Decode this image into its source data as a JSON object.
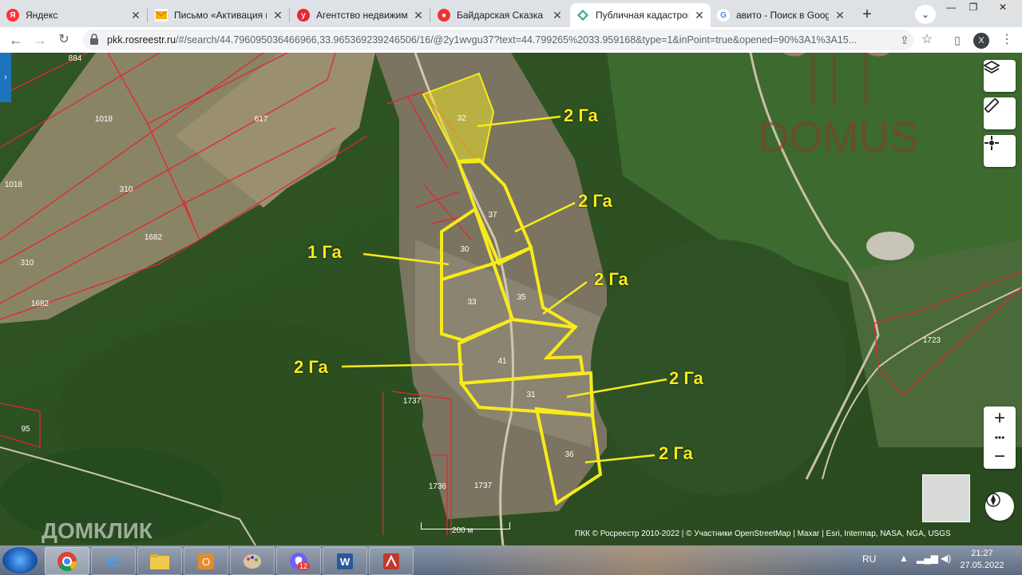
{
  "browser": {
    "tabs": [
      {
        "title": "Яндекс",
        "active": false,
        "fav_color": "#f33",
        "fav_glyph": "Я"
      },
      {
        "title": "Письмо «Активация п",
        "active": false,
        "fav_color": "#fff",
        "fav_glyph": "mail-icon"
      },
      {
        "title": "Агентство недвижимо",
        "active": false,
        "fav_color": "#e23",
        "fav_glyph": "y"
      },
      {
        "title": "Байдарская Сказка - '",
        "active": false,
        "fav_color": "#e33",
        "fav_glyph": "avito-icon"
      },
      {
        "title": "Публичная кадастрова",
        "active": true,
        "fav_color": "#3a9",
        "fav_glyph": "rosreestr-icon"
      },
      {
        "title": "авито - Поиск в Googl",
        "active": false,
        "fav_color": "#fff",
        "fav_glyph": "G"
      }
    ],
    "url_host": "pkk.rosreestr.ru",
    "url_rest": "/#/search/44.796095036466966,33.965369239246506/16/@2y1wvgu37?text=44.799265%2033.959168&type=1&inPoint=true&opened=90%3A1%3A15...",
    "avatar_letter": "X"
  },
  "map": {
    "annotations": [
      "2 Га",
      "2 Га",
      "1 Га",
      "2 Га",
      "2 Га",
      "2 Га",
      "2 Га"
    ],
    "parcel_labels": [
      "32",
      "37",
      "30",
      "35",
      "33",
      "41",
      "31",
      "36"
    ],
    "other_parcel_labels": [
      "1018",
      "617",
      "310",
      "1682",
      "1018",
      "310",
      "1682",
      "884",
      "1737",
      "1737",
      "1736",
      "95",
      "1723"
    ],
    "scale": "200 м",
    "attribution": "ПКК © Росреестр 2010-2022 | © Участники OpenStreetMap | Maxar | Esri, Intermap, NASA, NGA, USGS",
    "watermark": "ДОМКЛИК",
    "logo_text": "DOMUS",
    "accent": "#f7ea1b",
    "border_color": "#e5262e"
  },
  "taskbar": {
    "lang": "RU",
    "time": "21:27",
    "date": "27.05.2022",
    "viber_badge": "12"
  }
}
